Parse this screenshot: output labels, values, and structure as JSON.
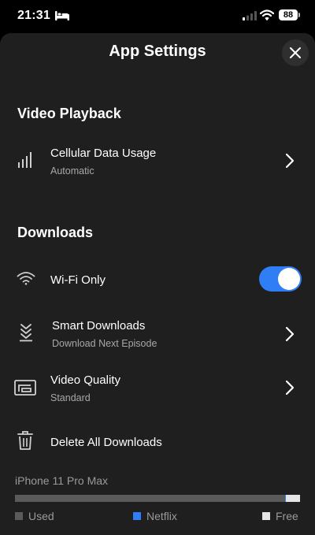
{
  "status_bar": {
    "time": "21:31",
    "battery": "88"
  },
  "sheet": {
    "title": "App Settings"
  },
  "video_playback": {
    "heading": "Video Playback",
    "cellular": {
      "title": "Cellular Data Usage",
      "value": "Automatic"
    }
  },
  "downloads": {
    "heading": "Downloads",
    "wifi_only": {
      "title": "Wi-Fi Only",
      "enabled": true
    },
    "smart_downloads": {
      "title": "Smart Downloads",
      "value": "Download Next Episode"
    },
    "video_quality": {
      "title": "Video Quality",
      "value": "Standard"
    },
    "delete_all": {
      "title": "Delete All Downloads"
    }
  },
  "storage": {
    "device": "iPhone 11 Pro Max",
    "used_fraction": 0.948,
    "netflix_fraction": 0.003,
    "free_fraction": 0.049,
    "legend": {
      "used": "Used",
      "netflix": "Netflix",
      "free": "Free"
    },
    "colors": {
      "used": "#5a5a5a",
      "netflix": "#2f7ef5",
      "free": "#e5e5e5"
    }
  },
  "colors": {
    "accent": "#2f7ef5",
    "sheet_background": "#1f1f1f"
  }
}
